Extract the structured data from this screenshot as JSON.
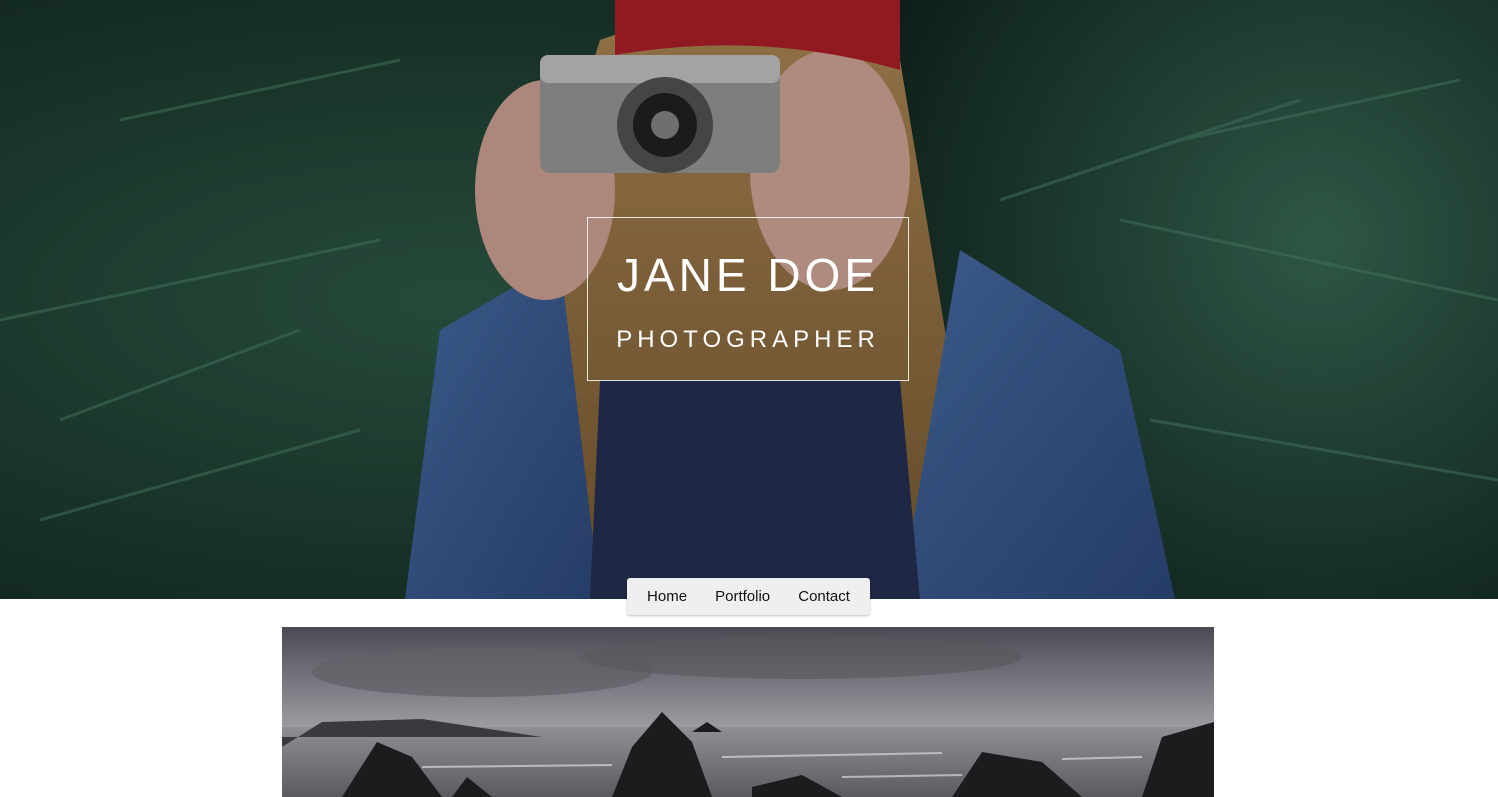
{
  "hero": {
    "name": "JANE DOE",
    "role": "PHOTOGRAPHER",
    "image_icon": "photographer-hero-photo"
  },
  "nav": {
    "items": [
      {
        "label": "Home"
      },
      {
        "label": "Portfolio"
      },
      {
        "label": "Contact"
      }
    ]
  },
  "gallery": {
    "image_icon": "coastal-rocks-photo"
  },
  "colors": {
    "nav_bg": "#efefef",
    "title_text": "#ffffff",
    "hero_dark": "#15302a"
  }
}
